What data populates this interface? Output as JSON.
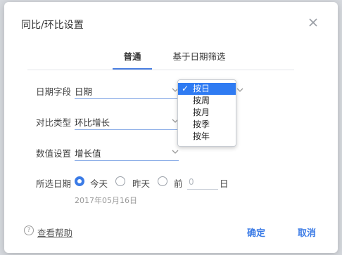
{
  "dialog": {
    "title": "同比/环比设置"
  },
  "tabs": [
    {
      "label": "普通",
      "active": true
    },
    {
      "label": "基于日期筛选",
      "active": false
    }
  ],
  "form": {
    "date_field": {
      "label": "日期字段",
      "value": "日期"
    },
    "compare_type": {
      "label": "对比类型",
      "value": "环比增长"
    },
    "value_setting": {
      "label": "数值设置",
      "value": "增长值"
    },
    "selected_date": {
      "label": "所选日期",
      "options": [
        {
          "label": "今天",
          "checked": true
        },
        {
          "label": "昨天",
          "checked": false
        },
        {
          "label": "前",
          "checked": false
        }
      ],
      "days_placeholder": "0",
      "days_suffix": "日",
      "date_note": "2017年05月16日"
    }
  },
  "dropdown": {
    "check_mark": "✓",
    "options": [
      {
        "label": "按日",
        "selected": true
      },
      {
        "label": "按周",
        "selected": false
      },
      {
        "label": "按月",
        "selected": false
      },
      {
        "label": "按季",
        "selected": false
      },
      {
        "label": "按年",
        "selected": false
      }
    ]
  },
  "footer": {
    "help_icon": "?",
    "help_label": "查看帮助",
    "confirm_label": "确定",
    "cancel_label": "取消"
  },
  "colors": {
    "accent": "#3b7be6",
    "selected_option_bg": "#2f7bf2"
  }
}
